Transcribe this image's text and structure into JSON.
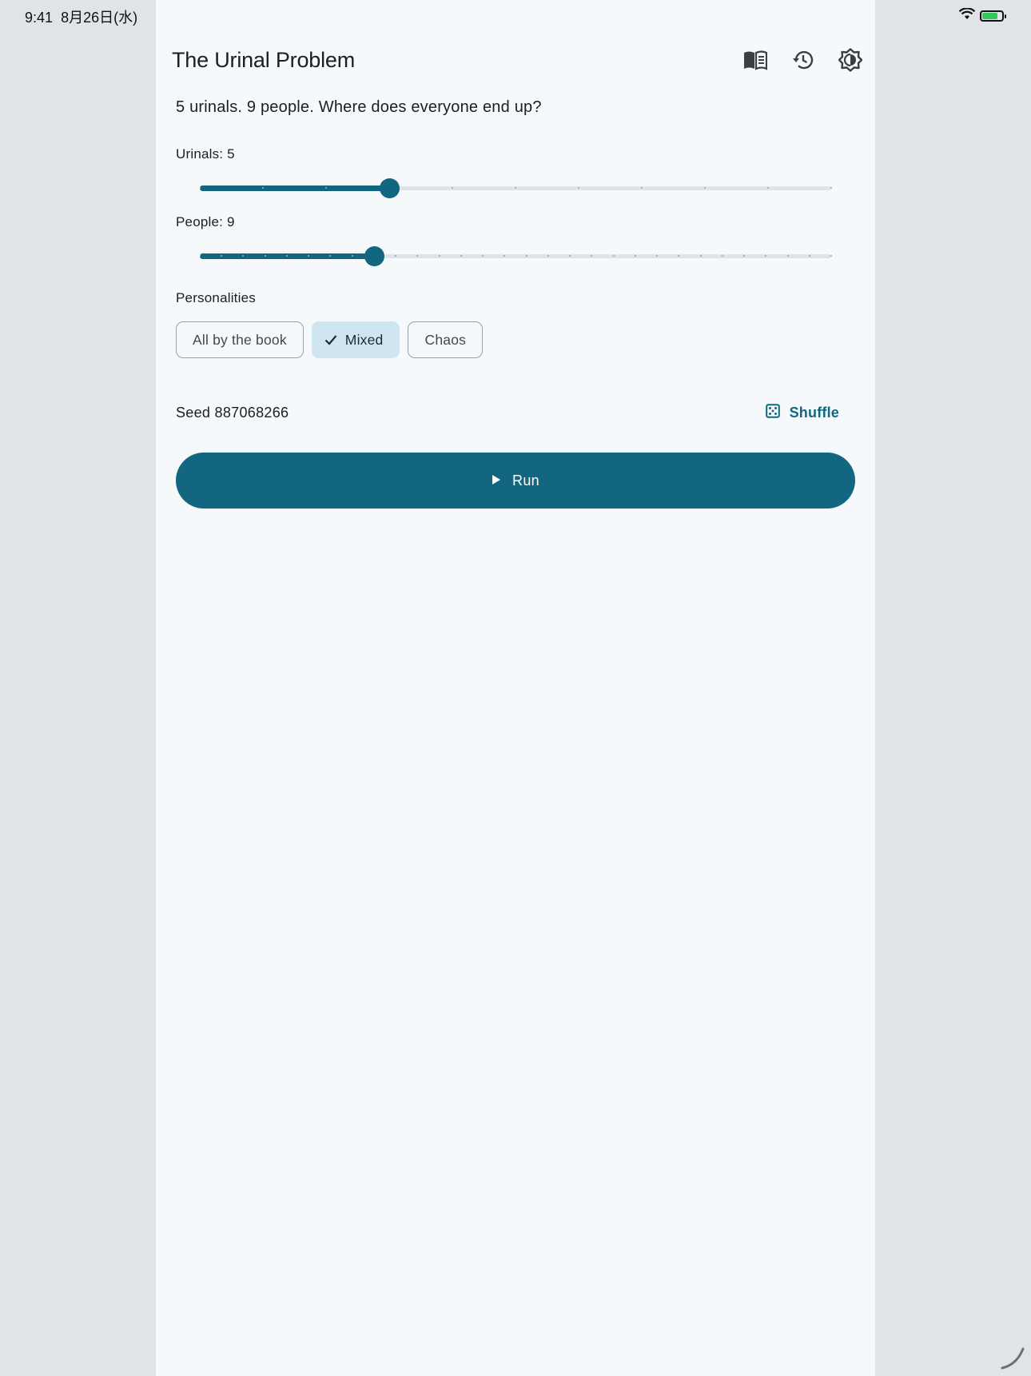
{
  "status_bar": {
    "time": "9:41",
    "date": "8月26日(水)",
    "battery_percent": 80,
    "battery_charging": true
  },
  "header": {
    "title": "The Urinal Problem",
    "icons": [
      "book-icon",
      "history-icon",
      "brightness-icon"
    ]
  },
  "headline": "5 urinals. 9 people. Where does everyone end up?",
  "urinals": {
    "label": "Urinals: 5",
    "value": 5,
    "min": 2,
    "max": 12
  },
  "people": {
    "label": "People: 9",
    "value": 9,
    "min": 1,
    "max": 30
  },
  "personalities": {
    "label": "Personalities",
    "options": [
      "All by the book",
      "Mixed",
      "Chaos"
    ],
    "selected": "Mixed"
  },
  "seed": {
    "label": "Seed 887068266",
    "shuffle_label": "Shuffle"
  },
  "run": {
    "label": "Run"
  },
  "colors": {
    "accent": "#13667f",
    "chip_selected": "#cfe6f2",
    "panel_bg": "#f5f9fc",
    "side_bg": "#e1e4e7"
  }
}
